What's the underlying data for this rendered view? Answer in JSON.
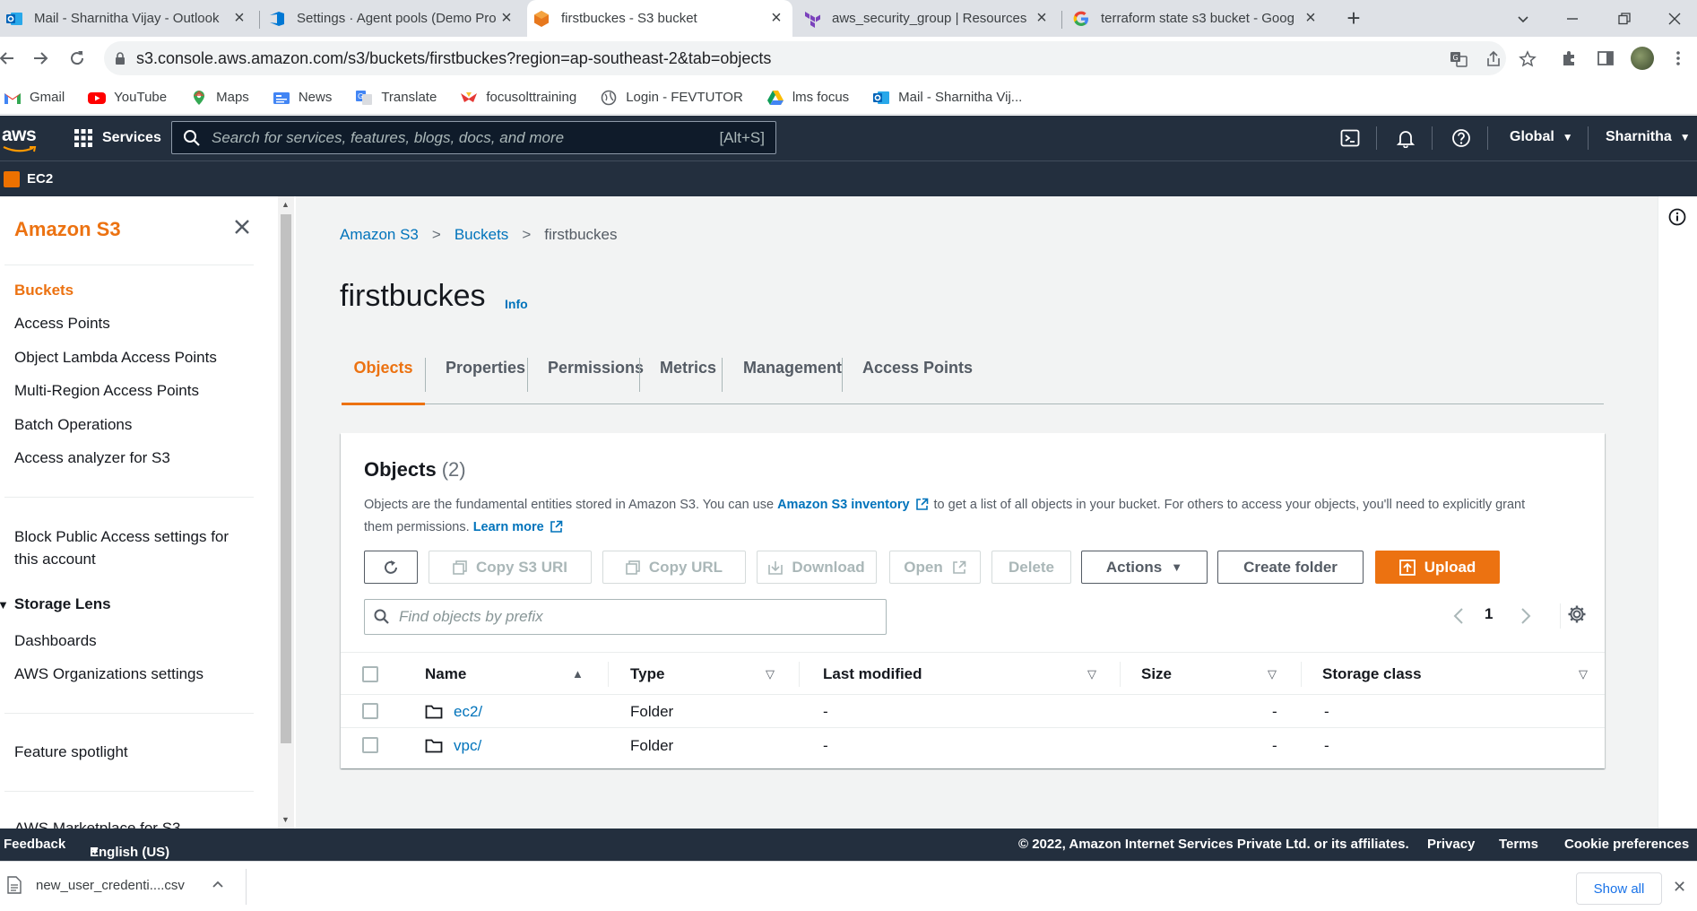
{
  "browser": {
    "tabs": [
      {
        "title": "Mail - Sharnitha Vijay - Outlook",
        "icon": "outlook-icon"
      },
      {
        "title": "Settings · Agent pools (Demo Pro",
        "icon": "azure-devops-icon"
      },
      {
        "title": "firstbuckes - S3 bucket",
        "icon": "s3-icon",
        "active": true
      },
      {
        "title": "aws_security_group | Resources |",
        "icon": "terraform-icon"
      },
      {
        "title": "terraform state s3 bucket - Goog",
        "icon": "google-icon"
      }
    ],
    "url": "s3.console.aws.amazon.com/s3/buckets/firstbuckes?region=ap-southeast-2&tab=objects",
    "bookmarks": [
      {
        "label": "Gmail",
        "icon": "gmail-icon"
      },
      {
        "label": "YouTube",
        "icon": "youtube-icon"
      },
      {
        "label": "Maps",
        "icon": "maps-icon"
      },
      {
        "label": "News",
        "icon": "news-icon"
      },
      {
        "label": "Translate",
        "icon": "translate-icon"
      },
      {
        "label": "focusolttraining",
        "icon": "focus-icon"
      },
      {
        "label": "Login - FEVTUTOR",
        "icon": "globe-icon"
      },
      {
        "label": "lms focus",
        "icon": "drive-icon"
      },
      {
        "label": "Mail - Sharnitha Vij...",
        "icon": "outlook-icon"
      }
    ]
  },
  "aws_nav": {
    "logo": "aws",
    "services_label": "Services",
    "search_placeholder": "Search for services, features, blogs, docs, and more",
    "search_shortcut": "[Alt+S]",
    "region": "Global",
    "user": "Sharnitha",
    "favorite": "EC2"
  },
  "sidebar": {
    "title": "Amazon S3",
    "items": [
      {
        "label": "Buckets",
        "active": true
      },
      {
        "label": "Access Points"
      },
      {
        "label": "Object Lambda Access Points"
      },
      {
        "label": "Multi-Region Access Points"
      },
      {
        "label": "Batch Operations"
      },
      {
        "label": "Access analyzer for S3"
      }
    ],
    "block_public": "Block Public Access settings for this account",
    "storage_lens": {
      "label": "Storage Lens",
      "items": [
        "Dashboards",
        "AWS Organizations settings"
      ]
    },
    "feature_spotlight": "Feature spotlight",
    "marketplace": "AWS Marketplace for S3"
  },
  "main": {
    "breadcrumbs": [
      "Amazon S3",
      "Buckets",
      "firstbuckes"
    ],
    "title": "firstbuckes",
    "info_label": "Info",
    "tabs": [
      "Objects",
      "Properties",
      "Permissions",
      "Metrics",
      "Management",
      "Access Points"
    ],
    "active_tab": "Objects"
  },
  "objects_panel": {
    "title": "Objects",
    "count": "(2)",
    "desc_1": "Objects are the fundamental entities stored in Amazon S3. You can use",
    "inventory_link": "Amazon S3 inventory",
    "desc_2": "to get a list of all objects in your bucket. For others to access your objects, you'll need to explicitly grant them permissions.",
    "learn_more": "Learn more",
    "buttons": {
      "copy_s3_uri": "Copy S3 URI",
      "copy_url": "Copy URL",
      "download": "Download",
      "open": "Open",
      "delete": "Delete",
      "actions": "Actions",
      "create_folder": "Create folder",
      "upload": "Upload"
    },
    "filter_placeholder": "Find objects by prefix",
    "page": "1",
    "columns": [
      "Name",
      "Type",
      "Last modified",
      "Size",
      "Storage class"
    ],
    "rows": [
      {
        "name": "ec2/",
        "type": "Folder",
        "last_modified": "-",
        "size": "-",
        "storage_class": "-"
      },
      {
        "name": "vpc/",
        "type": "Folder",
        "last_modified": "-",
        "size": "-",
        "storage_class": "-"
      }
    ]
  },
  "footer": {
    "feedback": "Feedback",
    "language": "English (US)",
    "copyright": "© 2022, Amazon Internet Services Private Ltd. or its affiliates.",
    "links": [
      "Privacy",
      "Terms",
      "Cookie preferences"
    ]
  },
  "download_shelf": {
    "file": "new_user_credenti....csv",
    "show_all": "Show all"
  },
  "colors": {
    "aws_orange": "#ec7211",
    "aws_navy": "#232f3e",
    "link_blue": "#0073bb"
  }
}
